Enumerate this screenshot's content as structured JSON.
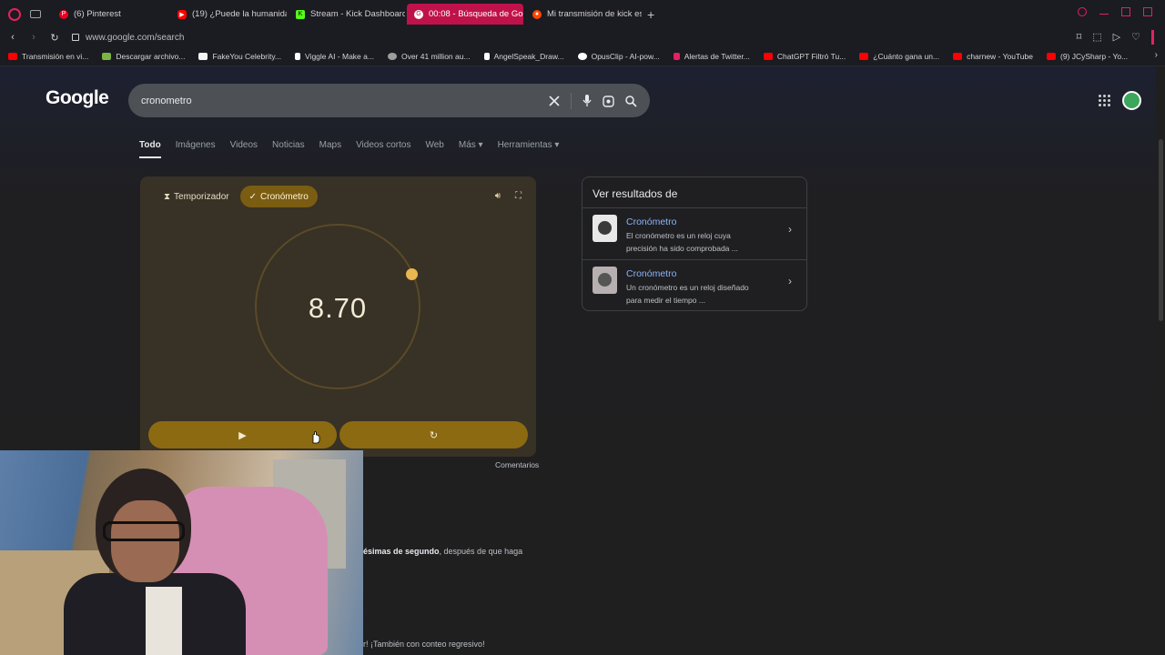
{
  "browser": {
    "tabs": [
      {
        "label": "(6) Pinterest",
        "color": "#e60023",
        "active": false
      },
      {
        "label": "(19) ¿Puede la humanidad",
        "color": "#ff0000",
        "active": false
      },
      {
        "label": "Stream - Kick Dashboard",
        "color": "#53fc18",
        "active": false
      },
      {
        "label": "00:08 - Búsqueda de Goo",
        "color": "#ffffff",
        "active": true
      },
      {
        "label": "Mi transmisión de kick est",
        "color": "#ff4500",
        "active": false
      }
    ],
    "url": "www.google.com/search",
    "bookmarks": [
      {
        "label": "Transmisión en vi...",
        "color": "#ff0000"
      },
      {
        "label": "Descargar archivo...",
        "color": "#7cb342"
      },
      {
        "label": "FakeYou Celebrity...",
        "color": "#f5f5f5"
      },
      {
        "label": "Viggle AI - Make a...",
        "color": "#ffffff"
      },
      {
        "label": "Over 41 million au...",
        "color": "#9e9e9e"
      },
      {
        "label": "AngelSpeak_Draw...",
        "color": "#ffffff"
      },
      {
        "label": "OpusClip - AI-pow...",
        "color": "#ffffff"
      },
      {
        "label": "Alertas de Twitter...",
        "color": "#e91e63"
      },
      {
        "label": "ChatGPT Filtró Tu...",
        "color": "#ff0000"
      },
      {
        "label": "¿Cuánto gana un...",
        "color": "#ff0000"
      },
      {
        "label": "charnew - YouTube",
        "color": "#ff0000"
      },
      {
        "label": "(9) JCySharp - Yo...",
        "color": "#ff0000"
      }
    ]
  },
  "google": {
    "logo": "Google",
    "query": "cronometro",
    "tabs": [
      "Todo",
      "Imágenes",
      "Videos",
      "Noticias",
      "Maps",
      "Videos cortos",
      "Web",
      "Más ▾",
      "Herramientas ▾"
    ]
  },
  "stopwatch": {
    "timer_tab": "Temporizador",
    "stopwatch_tab": "Cronómetro",
    "time": "8.70",
    "play_icon": "▶",
    "reset_icon": "↻",
    "feedback": "Comentarios"
  },
  "panel": {
    "title": "Ver resultados de",
    "items": [
      {
        "name": "Cronómetro",
        "desc": "El cronómetro es un reloj cuya precisión ha sido comprobada ..."
      },
      {
        "name": "Cronómetro",
        "desc": "Un cronómetro es un reloj diseñado para medir el tiempo ..."
      }
    ]
  },
  "snippets": {
    "s1_bold": "ésimas de segundo",
    "s1_rest": ", después de que haga",
    "s2": "r! ¡También con conteo regresivo!"
  }
}
